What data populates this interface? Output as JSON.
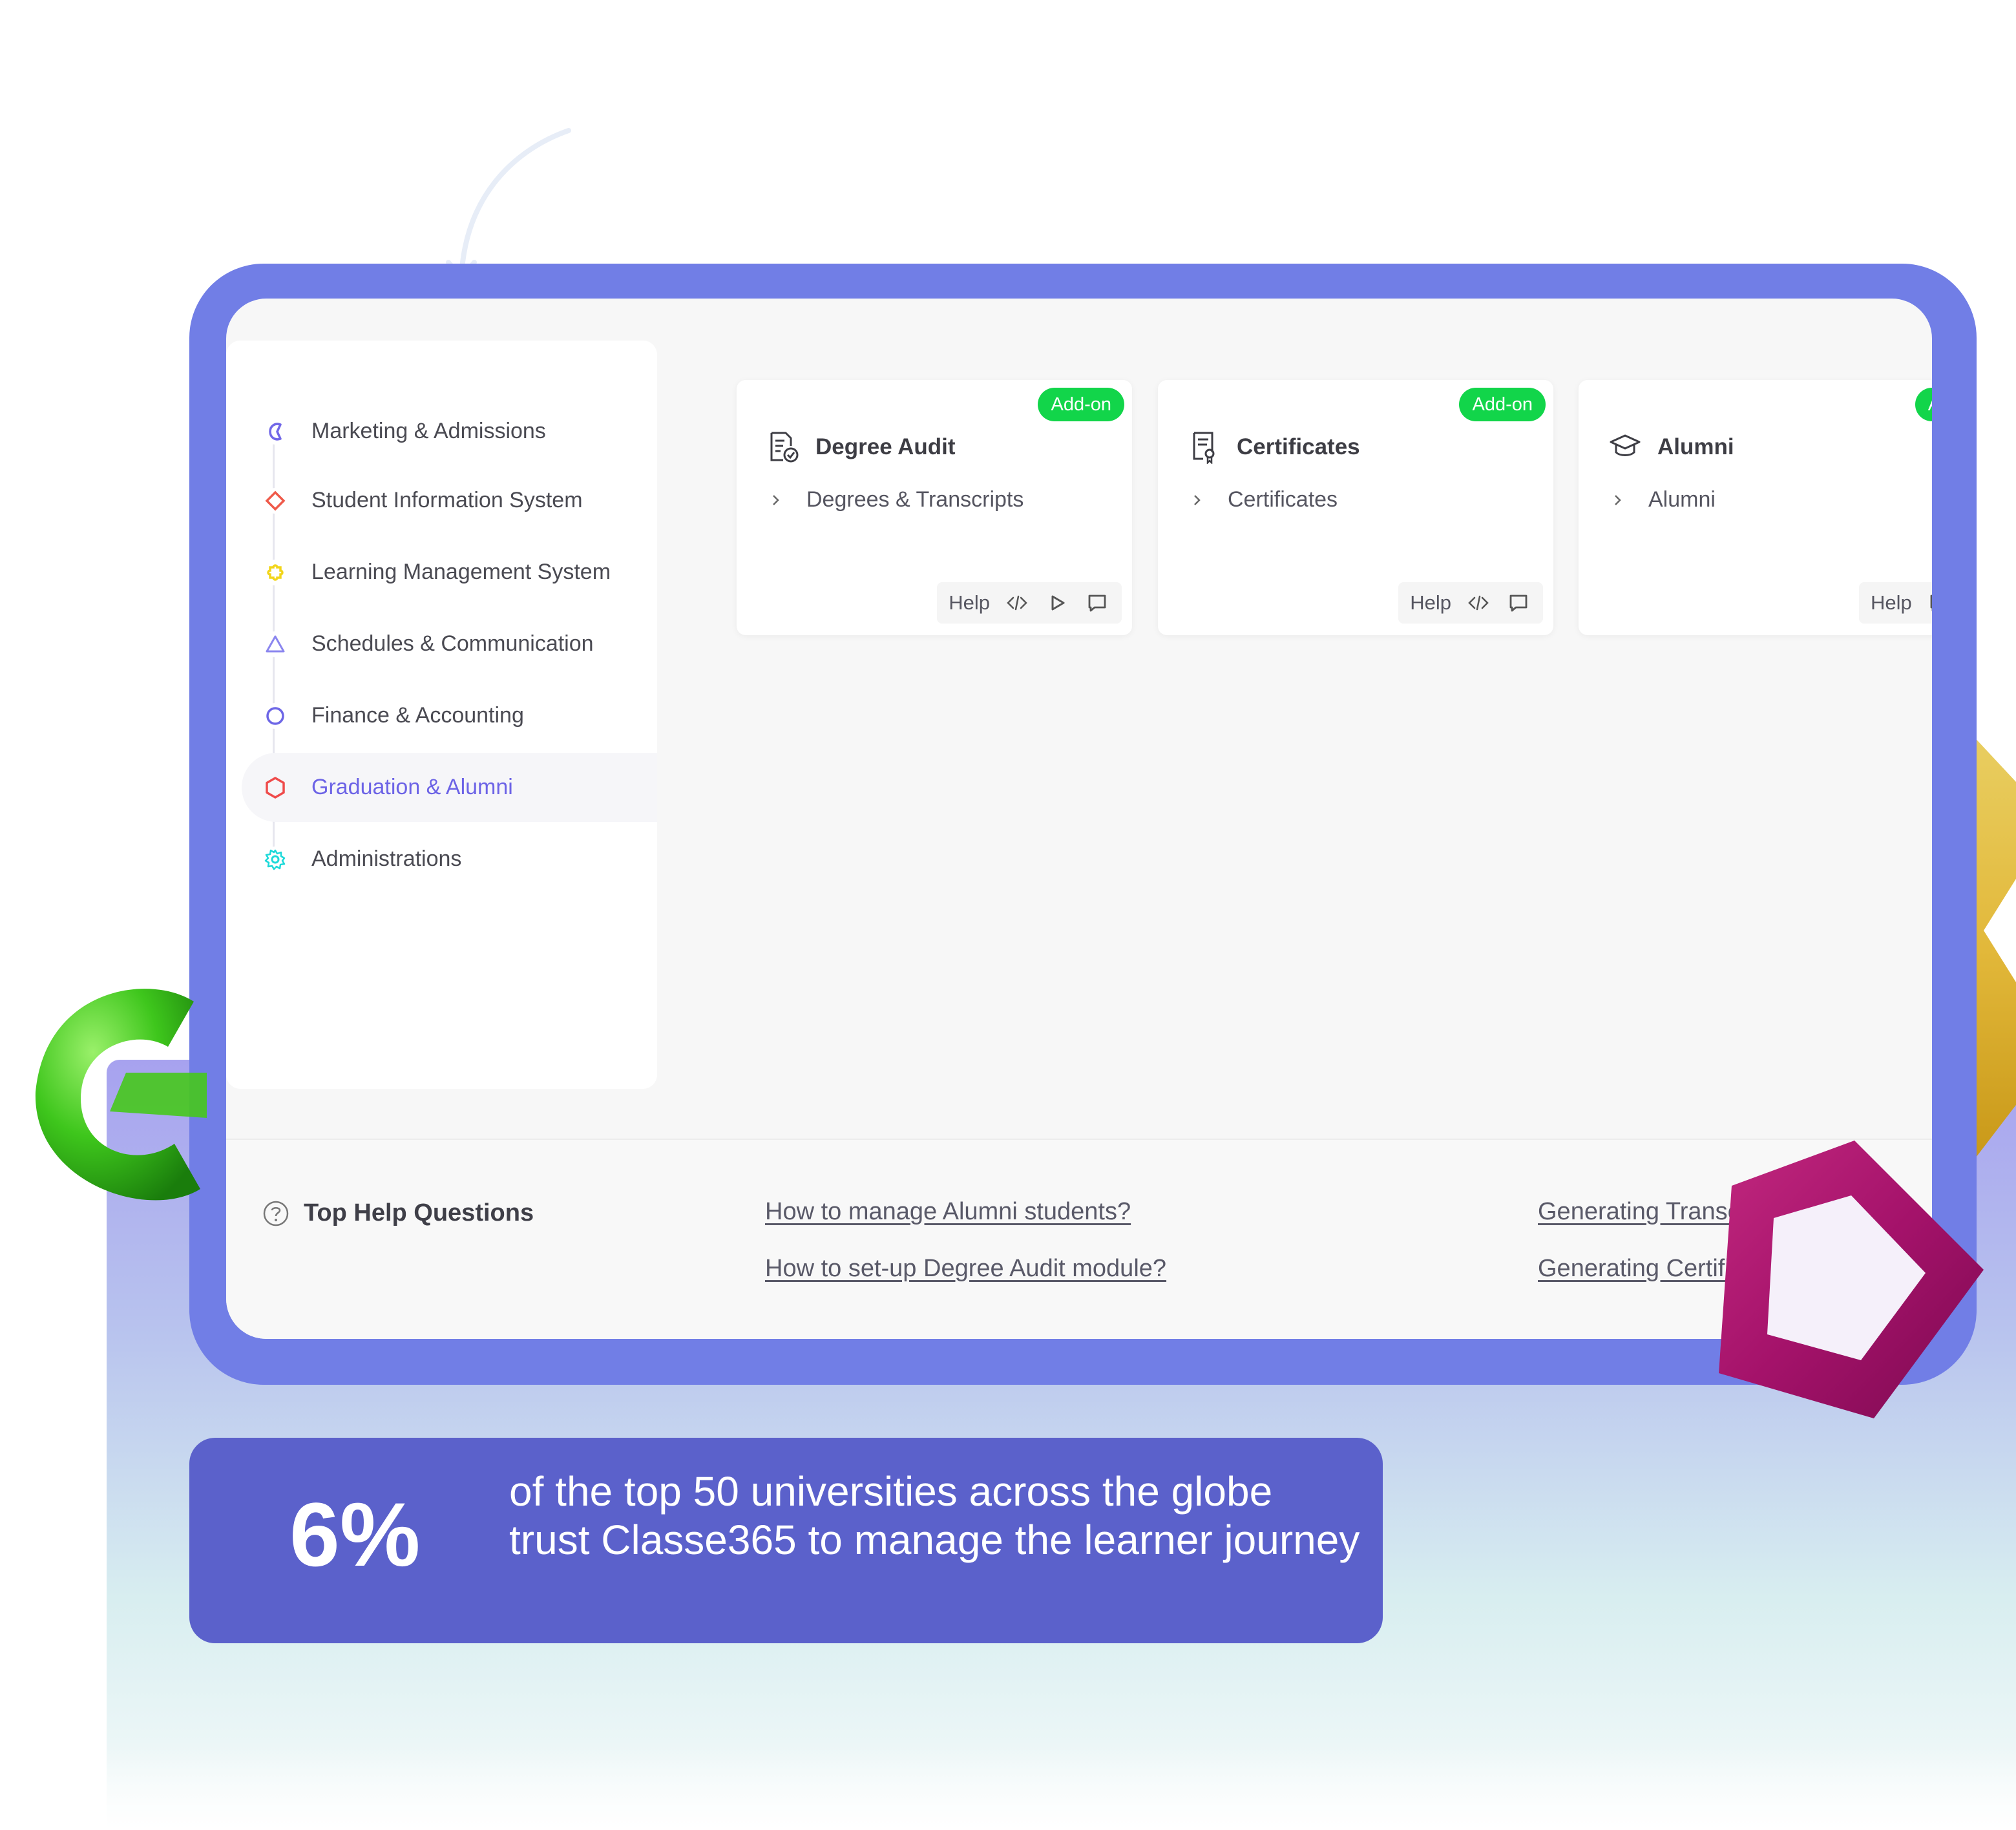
{
  "sidebar": {
    "items": [
      {
        "label": "Marketing & Admissions",
        "icon": "c-logo-icon",
        "color": "#7268e8"
      },
      {
        "label": "Student Information System",
        "icon": "diamond-icon",
        "color": "#ef5a4a"
      },
      {
        "label": "Learning Management System",
        "icon": "puzzle-icon",
        "color": "#f2d51b"
      },
      {
        "label": "Schedules & Communication",
        "icon": "triangle-icon",
        "color": "#8b86ef"
      },
      {
        "label": "Finance & Accounting",
        "icon": "circle-icon",
        "color": "#6d66e6"
      },
      {
        "label": "Graduation & Alumni",
        "icon": "hexagon-icon",
        "color": "#ef4b4b",
        "active": true
      },
      {
        "label": "Administrations",
        "icon": "gear-icon",
        "color": "#1dd9d9"
      }
    ]
  },
  "cards": [
    {
      "badge": "Add-on",
      "title": "Degree Audit",
      "icon": "document-check-icon",
      "link": "Degrees & Transcripts",
      "help": "Help",
      "actions": [
        "code-icon",
        "play-icon",
        "chat-icon"
      ]
    },
    {
      "badge": "Add-on",
      "title": "Certificates",
      "icon": "certificate-icon",
      "link": "Certificates",
      "help": "Help",
      "actions": [
        "code-icon",
        "chat-icon"
      ]
    },
    {
      "badge": "Add-",
      "title": "Alumni",
      "icon": "graduation-cap-icon",
      "link": "Alumni",
      "help": "Help",
      "actions": [
        "chat-icon"
      ]
    }
  ],
  "help": {
    "title": "Top Help Questions",
    "links": [
      "How to manage Alumni students?",
      "How to set-up Degree Audit module?",
      "Generating Transcripts",
      "Generating Certificates"
    ]
  },
  "stat": {
    "number": "6%",
    "text": "of the top 50 universities across the globe trust Classe365 to manage the learner journey"
  },
  "colors": {
    "frame": "#717ee6",
    "accent": "#6c63e6",
    "badge": "#12d54a",
    "stat_bg": "#5b61cb"
  }
}
